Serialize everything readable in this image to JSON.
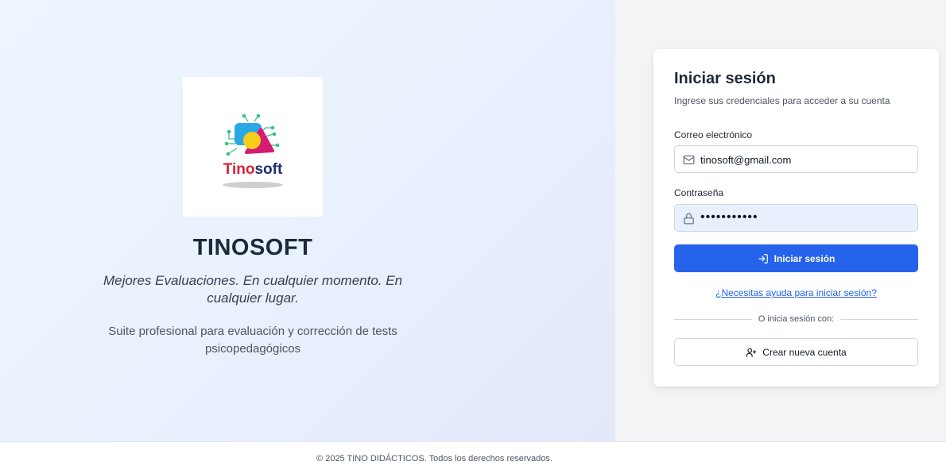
{
  "brand": {
    "logo_text": "Tinosoft",
    "title": "TINOSOFT",
    "tagline": "Mejores Evaluaciones. En cualquier momento. En cualquier lugar.",
    "description": "Suite profesional para evaluación y corrección de tests psicopedagógicos"
  },
  "login": {
    "title": "Iniciar sesión",
    "subtitle": "Ingrese sus credenciales para acceder a su cuenta",
    "email_label": "Correo electrónico",
    "email_value": "tinosoft@gmail.com",
    "email_icon": "mail-icon",
    "password_label": "Contraseña",
    "password_value": "•••••••••••",
    "password_icon": "lock-icon",
    "submit_label": "Iniciar sesión",
    "submit_icon": "log-in-icon",
    "help_link": "¿Necesitas ayuda para iniciar sesión?",
    "divider_text": "O inicia sesión con:",
    "create_account_label": "Crear nueva cuenta",
    "create_account_icon": "user-plus-icon"
  },
  "footer": {
    "text": "© 2025 TINO DIDÁCTICOS. Todos los derechos reservados."
  },
  "colors": {
    "primary": "#2563eb",
    "logo_red": "#d62236",
    "logo_navy": "#1e2d6b"
  }
}
